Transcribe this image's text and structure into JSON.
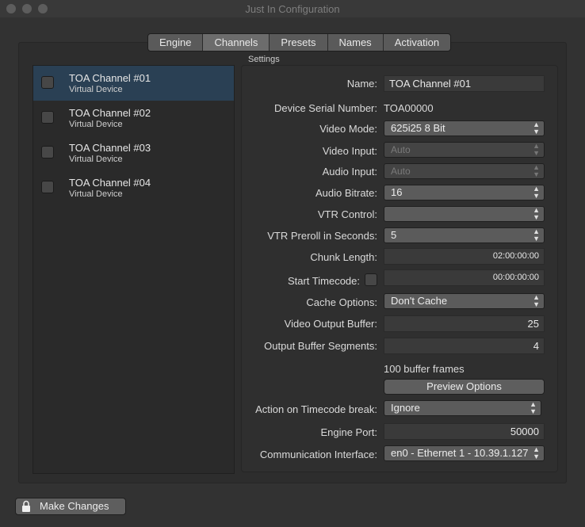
{
  "window": {
    "title": "Just In Configuration"
  },
  "tabs": [
    "Engine",
    "Channels",
    "Presets",
    "Names",
    "Activation"
  ],
  "channels": [
    {
      "name": "TOA Channel #01",
      "sub": "Virtual Device"
    },
    {
      "name": "TOA Channel #02",
      "sub": "Virtual Device"
    },
    {
      "name": "TOA Channel #03",
      "sub": "Virtual Device"
    },
    {
      "name": "TOA Channel #04",
      "sub": "Virtual Device"
    }
  ],
  "settings": {
    "group_label": "Settings",
    "name_label": "Name:",
    "name_value": "TOA Channel #01",
    "serial_label": "Device Serial Number:",
    "serial_value": "TOA00000",
    "video_mode_label": "Video Mode:",
    "video_mode_value": "625i25 8 Bit",
    "video_input_label": "Video Input:",
    "video_input_value": "Auto",
    "audio_input_label": "Audio Input:",
    "audio_input_value": "Auto",
    "audio_bitrate_label": "Audio Bitrate:",
    "audio_bitrate_value": "16",
    "vtr_control_label": "VTR Control:",
    "vtr_control_value": "",
    "vtr_preroll_label": "VTR Preroll in Seconds:",
    "vtr_preroll_value": "5",
    "chunk_length_label": "Chunk Length:",
    "chunk_length_value": "02:00:00:00",
    "start_tc_label": "Start Timecode:",
    "start_tc_value": "00:00:00:00",
    "cache_label": "Cache Options:",
    "cache_value": "Don't Cache",
    "vob_label": "Video Output Buffer:",
    "vob_value": "25",
    "obs_label": "Output Buffer Segments:",
    "obs_value": "4",
    "buffer_frames_text": "100 buffer frames",
    "preview_button": "Preview Options",
    "tc_break_label": "Action on Timecode break:",
    "tc_break_value": "Ignore",
    "port_label": "Engine Port:",
    "port_value": "50000",
    "iface_label": "Communication Interface:",
    "iface_value": "en0 - Ethernet 1 - 10.39.1.127"
  },
  "footer": {
    "make_changes": "Make Changes"
  }
}
